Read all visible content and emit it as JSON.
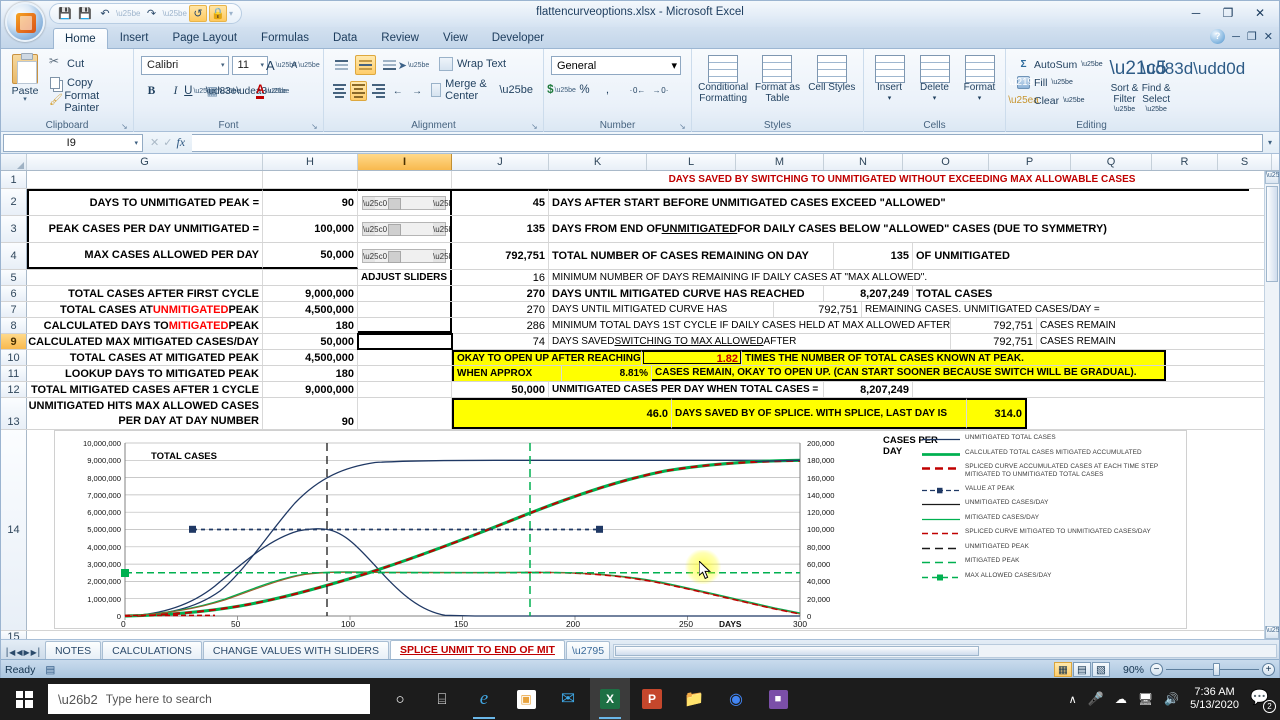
{
  "window": {
    "title": "flattencurveoptions.xlsx - Microsoft Excel",
    "minimize": "─",
    "restore": "❐",
    "close": "✕"
  },
  "quick_access": {
    "save": "💾",
    "save_as": "💾",
    "undo": "↶",
    "redo": "↷",
    "item4": "↺",
    "item5": "🔒",
    "more": "▾"
  },
  "ribbon": {
    "tabs": [
      {
        "label": "Home",
        "active": true
      },
      {
        "label": "Insert",
        "active": false
      },
      {
        "label": "Page Layout",
        "active": false
      },
      {
        "label": "Formulas",
        "active": false
      },
      {
        "label": "Data",
        "active": false
      },
      {
        "label": "Review",
        "active": false
      },
      {
        "label": "View",
        "active": false
      },
      {
        "label": "Developer",
        "active": false
      }
    ],
    "help": "?",
    "min_ribbon": "─",
    "restore_ribbon": "❐",
    "close_ribbon": "✕",
    "groups": {
      "clipboard": {
        "label": "Clipboard",
        "paste": "Paste",
        "paste_arrow": "▾",
        "cut": "Cut",
        "copy": "Copy",
        "format_painter": "Format Painter",
        "dialog": "↘"
      },
      "font": {
        "label": "Font",
        "font_name": "Calibri",
        "font_size": "11",
        "grow_font": "A",
        "shrink_font": "A",
        "bold": "B",
        "italic": "I",
        "underline": "U",
        "borders": "▦",
        "fill_color": "🎨",
        "font_color": "A",
        "dropdown": "▾",
        "dialog": "↘"
      },
      "alignment": {
        "label": "Alignment",
        "wrap_text": "Wrap Text",
        "merge_center": "Merge & Center",
        "orientation": "➤",
        "indent_dec": "←",
        "indent_inc": "→",
        "dropdown": "▾",
        "dialog": "↘"
      },
      "number": {
        "label": "Number",
        "format": "General",
        "currency": "$",
        "percent": "%",
        "comma": ",",
        "inc_decimal": "· 0←",
        "dec_decimal": "→ 0·",
        "dropdown": "▾",
        "dialog": "↘"
      },
      "styles": {
        "label": "Styles",
        "conditional_formatting": "Conditional Formatting",
        "format_as_table": "Format as Table",
        "cell_styles": "Cell Styles",
        "dropdown": "▾"
      },
      "cells": {
        "label": "Cells",
        "insert": "Insert",
        "delete": "Delete",
        "format": "Format",
        "dropdown": "▾"
      },
      "editing": {
        "label": "Editing",
        "autosum": "AutoSum",
        "fill": "Fill",
        "clear": "Clear",
        "sort_filter": "Sort & Filter",
        "find_select": "Find & Select",
        "dropdown": "▾",
        "sigma": "Σ"
      }
    }
  },
  "formula_bar": {
    "name_box": "I9",
    "name_box_arrow": "▾",
    "cancel": "✕",
    "enter": "✓",
    "fx": "fx",
    "formula": "",
    "expand": "▾"
  },
  "grid": {
    "columns": [
      "G",
      "H",
      "I",
      "J",
      "K",
      "L",
      "M",
      "N",
      "O",
      "P",
      "Q",
      "R",
      "S"
    ],
    "selected_column": "I",
    "selected_row": "9",
    "row_numbers": [
      "1",
      "2",
      "3",
      "4",
      "5",
      "6",
      "7",
      "8",
      "9",
      "10",
      "11",
      "12",
      "13",
      "14",
      "15"
    ],
    "rows": {
      "r1": {
        "banner": "DAYS SAVED BY SWITCHING TO UNMITIGATED WITHOUT EXCEEDING MAX ALLOWABLE CASES"
      },
      "r2": {
        "label": "DAYS TO UNMITIGATED PEAK =",
        "value": "90",
        "k": "45",
        "text": "DAYS AFTER START BEFORE UNMITIGATED CASES EXCEED \"ALLOWED\""
      },
      "r3": {
        "label": "PEAK CASES PER DAY UNMITIGATED =",
        "value": "100,000",
        "k": "135",
        "text_a": "DAYS FROM END OF ",
        "text_u": "UNMITIGATED",
        "text_b": " FOR DAILY CASES BELOW \"ALLOWED\" CASES (DUE TO SYMMETRY)"
      },
      "r4": {
        "label": "MAX CASES ALLOWED PER DAY",
        "value": "50,000",
        "k": "792,751",
        "text": "TOTAL NUMBER OF CASES REMAINING ON DAY",
        "n": "135",
        "text2": "OF UNMITIGATED"
      },
      "r5": {
        "slider_hint": "ADJUST SLIDERS",
        "k": "16",
        "text": "MINIMUM NUMBER OF DAYS REMAINING IF DAILY CASES AT \"MAX ALLOWED\"."
      },
      "r6": {
        "label": "TOTAL CASES AFTER FIRST CYCLE",
        "value": "9,000,000",
        "k": "270",
        "text": "DAYS UNTIL MITIGATED CURVE HAS REACHED",
        "n": "8,207,249",
        "text2": "TOTAL CASES"
      },
      "r7": {
        "label_a": "TOTAL CASES AT ",
        "label_red": "UNMITIGATED",
        "label_b": " PEAK",
        "value": "4,500,000",
        "k": "270",
        "text": "DAYS UNTIL MITIGATED CURVE HAS",
        "n": "792,751",
        "text2": "REMAINING CASES.  UNMITIGATED CASES/DAY ="
      },
      "r8": {
        "label_a": "CALCULATED DAYS TO ",
        "label_red": "MITIGATED",
        "label_b": " PEAK",
        "value": "180",
        "k": "286",
        "text": "MINIMUM TOTAL DAYS 1ST CYCLE IF DAILY CASES HELD AT MAX ALLOWED AFTER",
        "n": "792,751",
        "text2": "CASES REMAIN"
      },
      "r9": {
        "label": "CALCULATED MAX MITIGATED CASES/DAY",
        "value": "50,000",
        "k": "74",
        "text_a": "DAYS SAVED ",
        "text_u": "SWITCHING TO MAX ALLOWED",
        "text_b": " AFTER",
        "n": "792,751",
        "text2": "CASES REMAIN"
      },
      "r10": {
        "label": "TOTAL CASES AT MITIGATED PEAK",
        "value": "4,500,000",
        "text": "OKAY TO OPEN UP AFTER REACHING",
        "ratio": "1.82",
        "text2": "TIMES THE NUMBER OF TOTAL CASES KNOWN AT PEAK."
      },
      "r11": {
        "label": "LOOKUP DAYS TO MITIGATED PEAK",
        "value": "180",
        "text": "WHEN APPROX",
        "pct": "8.81%",
        "text2": "CASES REMAIN, OKAY TO OPEN UP.  (CAN START SOONER BECAUSE SWITCH WILL BE GRADUAL)."
      },
      "r12": {
        "label": "TOTAL MITIGATED CASES AFTER 1 CYCLE",
        "value": "9,000,000",
        "k": "50,000",
        "text": "UNMITIGATED CASES PER DAY WHEN TOTAL CASES =",
        "n": "8,207,249"
      },
      "r13": {
        "label_line1": "UNMITIGATED HITS MAX ALLOWED CASES",
        "label_line2": "PER DAY AT DAY NUMBER",
        "value": "90",
        "k": "46.0",
        "text": "DAYS SAVED BY OF SPLICE.  WITH SPLICE, LAST DAY IS",
        "n": "314.0"
      }
    }
  },
  "chart_data": {
    "type": "line",
    "title": "TOTAL CASES",
    "xlabel": "DAYS",
    "y_left_label": "",
    "y_right_label": "CASES PER DAY",
    "xlim": [
      0,
      300
    ],
    "xticks": [
      0,
      50,
      100,
      150,
      200,
      250,
      300
    ],
    "y_left_lim": [
      0,
      10000000
    ],
    "y_left_ticks": [
      "0",
      "1,000,000",
      "2,000,000",
      "3,000,000",
      "4,000,000",
      "5,000,000",
      "6,000,000",
      "7,000,000",
      "8,000,000",
      "9,000,000",
      "10,000,000"
    ],
    "y_right_lim": [
      0,
      200000
    ],
    "y_right_ticks": [
      "0",
      "20,000",
      "40,000",
      "60,000",
      "80,000",
      "100,000",
      "120,000",
      "140,000",
      "160,000",
      "180,000",
      "200,000"
    ],
    "grid": true,
    "legend_position": "right",
    "legend": [
      {
        "label": "UNMITIGATED TOTAL CASES",
        "color": "#1f3864",
        "style": "solid",
        "width": 1.2
      },
      {
        "label": "CALCULATED TOTAL CASES MITIGATED ACCUMULATED",
        "color": "#00b050",
        "style": "solid",
        "width": 2.6
      },
      {
        "label": "SPLICED CURVE ACCUMULATED CASES AT EACH TIME STEP MITIGATED TO UNMITIGATED TOTAL CASES",
        "color": "#c00000",
        "style": "dashed",
        "width": 2.4
      },
      {
        "label": "VALUE AT PEAK",
        "color": "#1f3864",
        "style": "dash-marker",
        "width": 1.2
      },
      {
        "label": "UNMITIGATED CASES/DAY",
        "color": "#1a1a1a",
        "style": "solid",
        "width": 1.2
      },
      {
        "label": "MITIGATED CASES/DAY",
        "color": "#00b050",
        "style": "solid",
        "width": 1.2
      },
      {
        "label": "SPLICED CURVE MITIGATED TO UNMITIGATED CASES/DAY",
        "color": "#c00000",
        "style": "dashed",
        "width": 1.4
      },
      {
        "label": "UNMITIGATED PEAK",
        "color": "#1a1a1a",
        "style": "dashed",
        "width": 1.2
      },
      {
        "label": "MITIGATED PEAK",
        "color": "#00b050",
        "style": "dashed",
        "width": 1.2
      },
      {
        "label": "MAX ALLOWED CASES/DAY",
        "color": "#00b050",
        "style": "dash-marker",
        "width": 1.2
      }
    ],
    "series": [
      {
        "name": "UNMITIGATED TOTAL CASES",
        "axis": "left",
        "peak_day": 90,
        "plateau_value": 9000000
      },
      {
        "name": "CALCULATED TOTAL CASES MITIGATED ACCUMULATED",
        "axis": "left",
        "peak_day": 180,
        "plateau_value": 9000000
      },
      {
        "name": "UNMITIGATED CASES/DAY",
        "axis": "right",
        "peak_day": 90,
        "peak_value": 100000
      },
      {
        "name": "MITIGATED CASES/DAY",
        "axis": "right",
        "peak_day": 180,
        "peak_value": 50000
      }
    ],
    "reference_lines": [
      {
        "name": "UNMITIGATED PEAK",
        "x": 90,
        "color": "#1a1a1a"
      },
      {
        "name": "MITIGATED PEAK",
        "x": 180,
        "color": "#00b050"
      },
      {
        "name": "VALUE AT PEAK",
        "y_right": 100000,
        "color": "#1f3864"
      },
      {
        "name": "MAX ALLOWED CASES/DAY",
        "y_right": 50000,
        "color": "#00b050"
      }
    ]
  },
  "sheet_tabs": {
    "first": "⎮◀",
    "prev": "◀",
    "next": "▶",
    "last": "▶⎮",
    "tabs": [
      {
        "label": "NOTES",
        "active": false
      },
      {
        "label": "CALCULATIONS",
        "active": false
      },
      {
        "label": "CHANGE VALUES WITH SLIDERS",
        "active": false
      },
      {
        "label": "SPLICE UNMIT TO END OF MIT",
        "active": true
      }
    ],
    "new_sheet": "➕"
  },
  "status_bar": {
    "status": "Ready",
    "macro_icon": "▤",
    "view_normal": "▦",
    "view_layout": "▤",
    "view_break": "▧",
    "zoom": "90%",
    "zoom_out": "−",
    "zoom_in": "+"
  },
  "taskbar": {
    "search_placeholder": "Type here to search",
    "search_icon": "🔍",
    "cortana": "○",
    "task_view": "⌸",
    "edge": "e",
    "store": "▣",
    "mail": "✉",
    "excel": "X",
    "powerpoint": "P",
    "explorer": "📁",
    "chrome": "◉",
    "app2": "■",
    "chevron_up": "∧",
    "mic": "🎤",
    "onedrive": "☁",
    "network": "🖥",
    "volume": "🔊",
    "time": "7:36 AM",
    "date": "5/13/2020",
    "notifications": "💬",
    "notification_count": "2"
  }
}
